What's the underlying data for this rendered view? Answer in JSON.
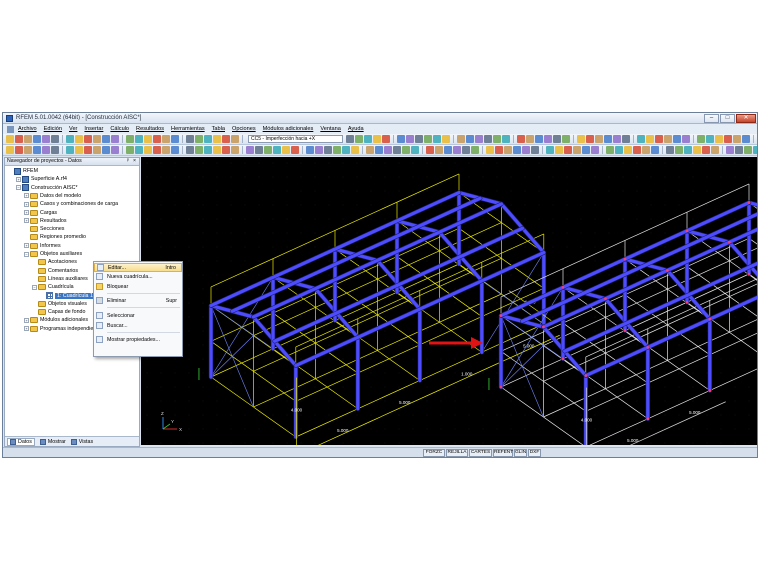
{
  "window": {
    "title": "RFEM 5.01.0042 (64bit) - [Construcción AISC*]",
    "controls": [
      "–",
      "□",
      "✕"
    ]
  },
  "menu": [
    "Archivo",
    "Edición",
    "Ver",
    "Insertar",
    "Cálculo",
    "Resultados",
    "Herramientas",
    "Tabla",
    "Opciones",
    "Módulos adicionales",
    "Ventana",
    "Ayuda"
  ],
  "toolbar": {
    "load_case": "CC5 - Imperfección hacia +X"
  },
  "navigator": {
    "header": "Navegador de proyectos - Datos",
    "pin": "ᵖ",
    "close": "×",
    "root": "RFEM",
    "tree": [
      {
        "label": "Superficie A.rf4",
        "icon": "model"
      },
      {
        "label": "Construcción AISC*",
        "icon": "model"
      },
      {
        "label": "Datos del modelo",
        "icon": "folder"
      },
      {
        "label": "Casos y combinaciones de carga",
        "icon": "folder"
      },
      {
        "label": "Cargas",
        "icon": "folder"
      },
      {
        "label": "Resultados",
        "icon": "folder"
      },
      {
        "label": "Secciones",
        "icon": "folder"
      },
      {
        "label": "Regiones promedio",
        "icon": "folder"
      },
      {
        "label": "Informes",
        "icon": "folder"
      },
      {
        "label": "Objetos auxiliares",
        "icon": "folder"
      },
      {
        "label": "Acotaciones",
        "icon": "folder"
      },
      {
        "label": "Comentarios",
        "icon": "folder"
      },
      {
        "label": "Líneas auxiliares",
        "icon": "folder"
      },
      {
        "label": "Cuadrícula",
        "icon": "folder"
      },
      {
        "label": "1: Cuadrícula 1",
        "icon": "grid"
      },
      {
        "label": "Objetos visuales",
        "icon": "folder"
      },
      {
        "label": "Capas de fondo",
        "icon": "folder"
      },
      {
        "label": "Módulos adicionales",
        "icon": "folder"
      },
      {
        "label": "Programas independientes",
        "icon": "folder"
      }
    ],
    "tabs": [
      "Datos",
      "Mostrar",
      "Vistas"
    ]
  },
  "context_menu": {
    "items": [
      {
        "label": "Editar...",
        "shortcut": "Intro"
      },
      {
        "label": "Nueva cuadrícula...",
        "shortcut": ""
      },
      {
        "label": "Bloquear",
        "shortcut": ""
      },
      {
        "label": "Eliminar",
        "shortcut": "Supr"
      },
      {
        "label": "Seleccionar",
        "shortcut": ""
      },
      {
        "label": "Buscar...",
        "shortcut": ""
      },
      {
        "label": "Mostrar propiedades...",
        "shortcut": ""
      }
    ]
  },
  "viewport": {
    "dimensions": [
      "5.000",
      "5.000",
      "4.000",
      "1.000",
      "5.000",
      "4.000",
      "5.000",
      "5.000"
    ],
    "axes": [
      "X",
      "Y",
      "Z"
    ],
    "arrow_color": "#e01414",
    "grid_color": "#e8e800",
    "member_color": "#4d4dff"
  },
  "status_bar": [
    "FORZC",
    "REJILLA",
    "CARTES",
    "REFENT",
    "GLIN",
    "DXF"
  ]
}
